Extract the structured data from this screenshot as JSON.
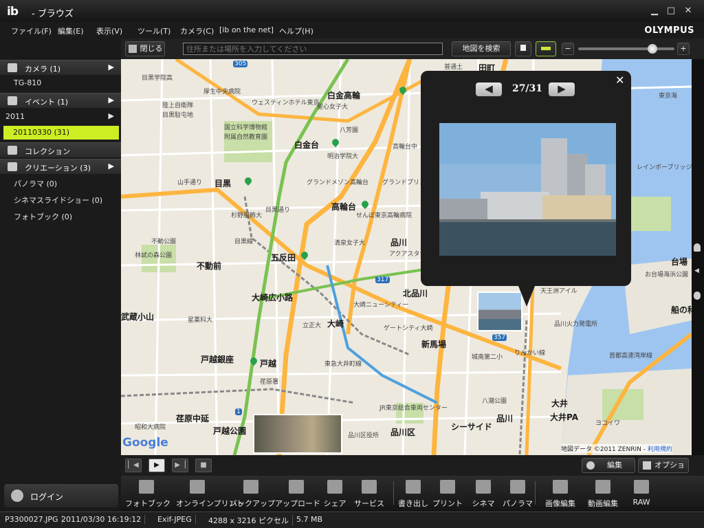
{
  "window": {
    "logo": "ib",
    "title": "- ブラウズ",
    "minimize": "▁",
    "maximize": "□",
    "close": "✕"
  },
  "menu": [
    "ファイル(F)",
    "編集(E)",
    "表示(V)",
    "ツール(T)",
    "カメラ(C)",
    "[ib on the net]",
    "ヘルプ(H)"
  ],
  "brand": "OLYMPUS",
  "toolbar": {
    "close_label": "閉じる",
    "address_placeholder": "住所または場所を入力してください",
    "search_label": "地図を検索",
    "zoom_minus": "−",
    "zoom_plus": "+",
    "zoom_level": 0.8
  },
  "sidebar": {
    "camera": "カメラ (1)",
    "camera_item": "TG-810",
    "event": "イベント (1)",
    "year": "2011",
    "selected_event": "20110330 (31)",
    "collection": "コレクション",
    "creation": "クリエーション (3)",
    "creation_items": [
      "パノラマ (0)",
      "シネマスライドショー (0)",
      "フォトブック (0)"
    ]
  },
  "popup": {
    "counter": "27/31",
    "prev": "◀",
    "next": "▶",
    "close": "✕"
  },
  "map": {
    "labels": [
      {
        "t": "目黒学院高",
        "b": false
      },
      {
        "t": "厚生中央病院",
        "b": false
      },
      {
        "t": "陸上自衛隊",
        "b": false
      },
      {
        "t": "目黒駐屯地",
        "b": false
      },
      {
        "t": "ウェスティンホテル東京",
        "b": false
      },
      {
        "t": "聖心女子大",
        "b": false
      },
      {
        "t": "国立科学博物館",
        "b": false
      },
      {
        "t": "附属自然教育園",
        "b": false
      },
      {
        "t": "白金高輪",
        "b": true
      },
      {
        "t": "白金台",
        "b": true
      },
      {
        "t": "明治学院大",
        "b": false
      },
      {
        "t": "高輪台中",
        "b": false
      },
      {
        "t": "目黒",
        "b": true
      },
      {
        "t": "グランドメゾン高輪台",
        "b": false
      },
      {
        "t": "グランドプリンスホテル新高輪",
        "b": false
      },
      {
        "t": "高輪台",
        "b": true
      },
      {
        "t": "せんぼ東京高輪病院",
        "b": false
      },
      {
        "t": "杉野服飾大",
        "b": false
      },
      {
        "t": "清泉女子大",
        "b": false
      },
      {
        "t": "品川",
        "b": true
      },
      {
        "t": "アクアスタジアム",
        "b": false
      },
      {
        "t": "不動前",
        "b": true
      },
      {
        "t": "五反田",
        "b": true
      },
      {
        "t": "林試の森公園",
        "b": false
      },
      {
        "t": "目黒線",
        "b": false
      },
      {
        "t": "北品川",
        "b": true
      },
      {
        "t": "大崎広小路",
        "b": true
      },
      {
        "t": "大崎ニューシティー",
        "b": false
      },
      {
        "t": "武蔵小山",
        "b": true
      },
      {
        "t": "大崎",
        "b": true
      },
      {
        "t": "立正大",
        "b": false
      },
      {
        "t": "ゲートシティ大崎",
        "b": false
      },
      {
        "t": "新馬場",
        "b": true
      },
      {
        "t": "戸越銀座",
        "b": true
      },
      {
        "t": "戸越",
        "b": true
      },
      {
        "t": "荏原署",
        "b": false
      },
      {
        "t": "東急大井町線",
        "b": false
      },
      {
        "t": "荏原中延",
        "b": true
      },
      {
        "t": "戸越公園",
        "b": true
      },
      {
        "t": "昭和大病院",
        "b": false
      },
      {
        "t": "JR東京総合車両センター",
        "b": false
      },
      {
        "t": "品川区",
        "b": true
      },
      {
        "t": "品川区役所",
        "b": false
      },
      {
        "t": "シーサイド",
        "b": true
      },
      {
        "t": "品川",
        "b": true
      },
      {
        "t": "大井PA",
        "b": true
      },
      {
        "t": "八潮公園",
        "b": false
      },
      {
        "t": "大井",
        "b": true
      },
      {
        "t": "品川火力発電所",
        "b": false
      },
      {
        "t": "東京海",
        "b": false
      },
      {
        "t": "レインボーブリッジ",
        "b": false
      },
      {
        "t": "台場",
        "b": true
      },
      {
        "t": "船の科学",
        "b": true
      },
      {
        "t": "お台場海浜公園",
        "b": false
      },
      {
        "t": "首都高速湾岸線",
        "b": false
      },
      {
        "t": "りんかい線",
        "b": false
      },
      {
        "t": "ヨコイワ",
        "b": false
      },
      {
        "t": "田町",
        "b": true
      },
      {
        "t": "普通土",
        "b": false
      },
      {
        "t": "天王洲アイル",
        "b": false
      },
      {
        "t": "城南第二小",
        "b": false
      },
      {
        "t": "星薬科大",
        "b": false
      },
      {
        "t": "八芳園",
        "b": false
      },
      {
        "t": "目黒通り",
        "b": false
      },
      {
        "t": "山手通り",
        "b": false
      },
      {
        "t": "不動公園",
        "b": false
      }
    ],
    "routes": [
      "305",
      "317",
      "357",
      "1"
    ],
    "attribution": "地図データ ©2011 ZENRIN",
    "terms": "利用規約",
    "google": "Google"
  },
  "playback": {
    "prev": "▏◀",
    "play": "▶",
    "next": "▶▕",
    "stop": "■"
  },
  "map_actions": {
    "edit": "編集",
    "options": "オプション"
  },
  "bottombar": {
    "left": [
      "フォトブック",
      "オンラインプリント",
      "バックアップ",
      "アップロード",
      "シェア",
      "サービス"
    ],
    "right": [
      "書き出し",
      "プリント",
      "シネマ",
      "パノラマ",
      "画像編集",
      "動画編集",
      "RAW"
    ]
  },
  "login": "ログイン",
  "status": {
    "file": "P3300027.JPG",
    "date": "2011/03/30 16:19:12",
    "format": "Exif-JPEG",
    "size_px": "4288 x 3216 ピクセル",
    "size_mb": "5.7 MB"
  },
  "colors": {
    "selected": "#ccee22",
    "water": "#9ec5f0",
    "map_land": "#ede9df",
    "park": "#c8dfa8",
    "road_major": "#fdb540",
    "road_minor": "#fff",
    "route_green": "#7ac251"
  }
}
